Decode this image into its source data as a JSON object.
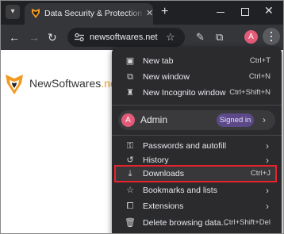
{
  "browser": {
    "tab": {
      "title": "Data Security & Protection Software"
    },
    "new_tab_symbol": "+",
    "window_controls": {
      "minimize": "—",
      "maximize": "□",
      "close": "✕"
    },
    "omnibox": {
      "url": "newsoftwares.net"
    },
    "profile_initial": "A"
  },
  "page": {
    "logo": {
      "brand_main": "NewSoftwares",
      "brand_tld": ".net"
    }
  },
  "menu": {
    "group1": [
      {
        "icon": "new-tab-icon",
        "label": "New tab",
        "shortcut": "Ctrl+T"
      },
      {
        "icon": "new-window-icon",
        "label": "New window",
        "shortcut": "Ctrl+N"
      },
      {
        "icon": "incognito-icon",
        "label": "New Incognito window",
        "shortcut": "Ctrl+Shift+N"
      }
    ],
    "profile": {
      "initial": "A",
      "name": "Admin",
      "badge": "Signed in"
    },
    "group2": [
      {
        "icon": "key-icon",
        "label": "Passwords and autofill",
        "has_submenu": true
      },
      {
        "icon": "history-icon",
        "label": "History",
        "has_submenu": true
      },
      {
        "icon": "download-icon",
        "label": "Downloads",
        "shortcut": "Ctrl+J",
        "highlighted": true
      },
      {
        "icon": "star-icon",
        "label": "Bookmarks and lists",
        "has_submenu": true
      },
      {
        "icon": "extensions-icon",
        "label": "Extensions",
        "has_submenu": true
      },
      {
        "icon": "trash-icon",
        "label": "Delete browsing data...",
        "shortcut": "Ctrl+Shift+Del"
      }
    ]
  },
  "colors": {
    "highlight_border": "#e8232c",
    "badge_bg": "#5c4a88",
    "avatar": "#e25b79",
    "brand_accent": "#f39a21"
  }
}
